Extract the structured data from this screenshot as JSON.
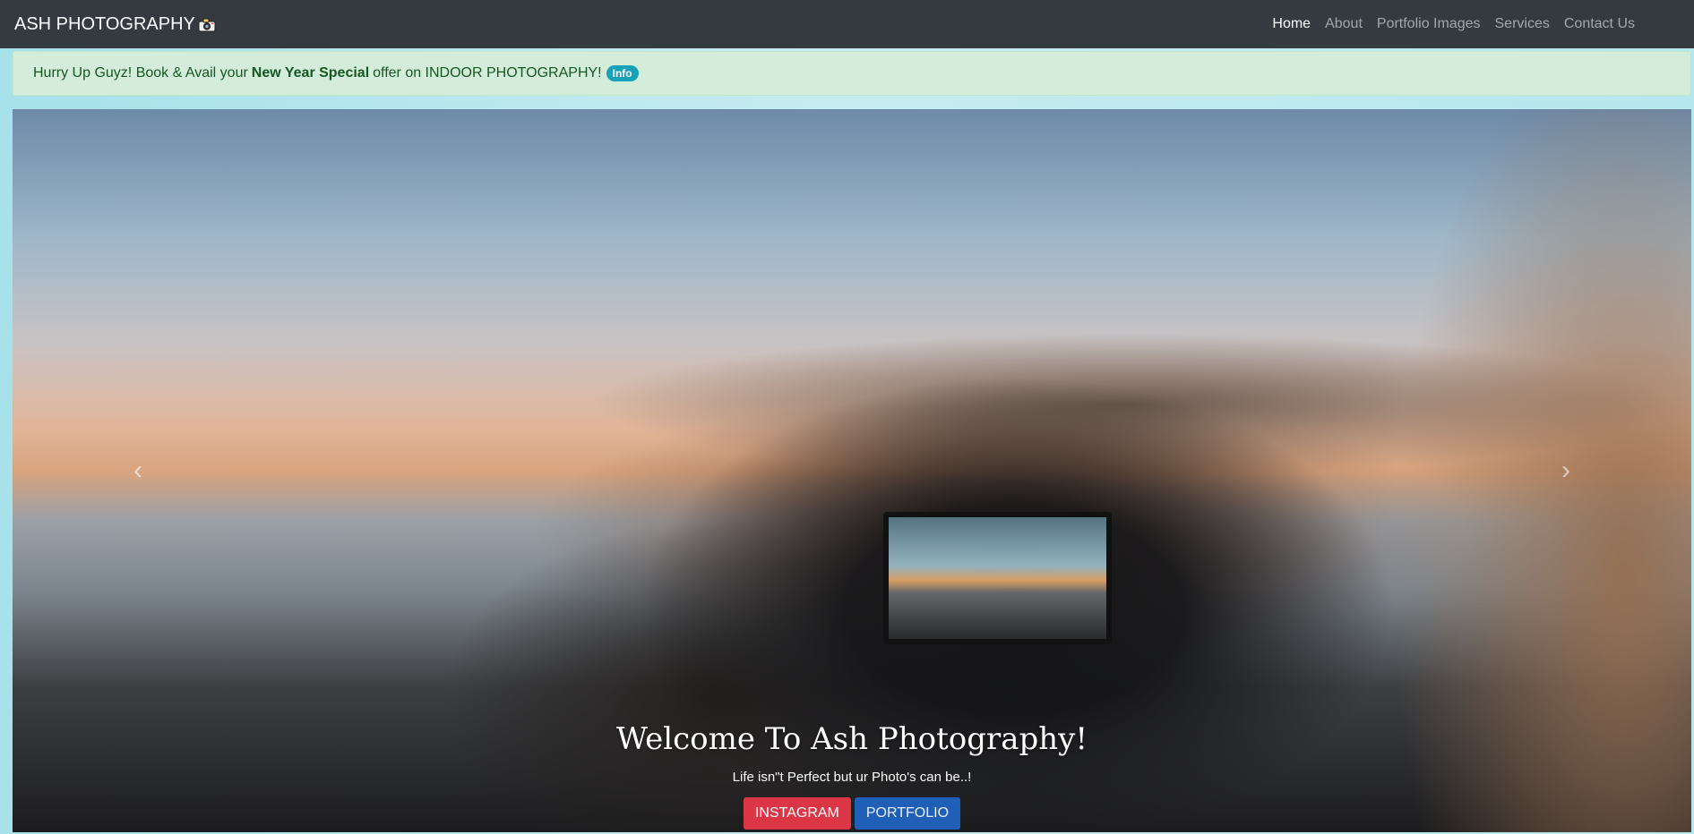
{
  "navbar": {
    "brand": "ASH PHOTOGRAPHY",
    "brand_icon": "camera-icon",
    "links": [
      {
        "label": "Home",
        "active": true
      },
      {
        "label": "About",
        "active": false
      },
      {
        "label": "Portfolio Images",
        "active": false
      },
      {
        "label": "Services",
        "active": false
      },
      {
        "label": "Contact Us",
        "active": false
      }
    ]
  },
  "alert": {
    "text_before": "Hurry Up Guyz! Book & Avail your",
    "strong": "New Year Special",
    "text_after": "offer on INDOOR PHOTOGRAPHY!",
    "badge": "Info"
  },
  "carousel": {
    "prev_icon": "chevron-left-icon",
    "next_icon": "chevron-right-icon",
    "prev_glyph": "‹",
    "next_glyph": "›",
    "caption": {
      "title": "Welcome To Ash Photography!",
      "subtitle": "Life isn\"t Perfect but ur Photo's can be..!",
      "buttons": [
        "INSTAGRAM",
        "PORTFOLIO"
      ]
    }
  },
  "colors": {
    "navbar": "#343a40",
    "alert_bg": "#d4edda",
    "alert_text": "#155724",
    "badge": "#17a2b8",
    "danger": "#dc3545",
    "primary": "#1f5fb8"
  }
}
